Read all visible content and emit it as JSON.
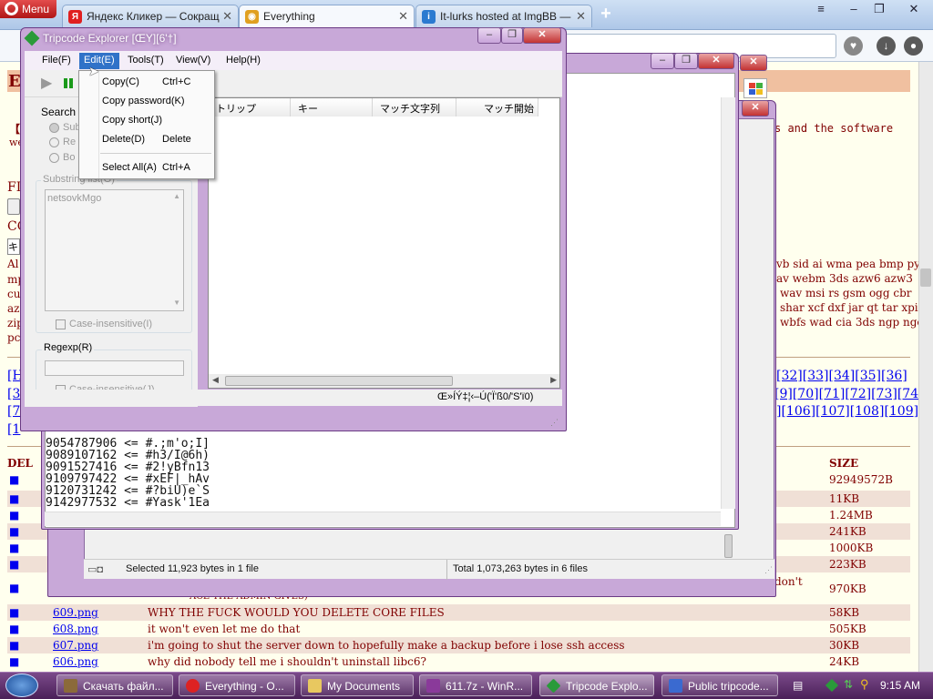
{
  "browser": {
    "menu_label": "Menu",
    "tabs": [
      {
        "label": "Яндекс Кликер — Сокращ",
        "icon": "yandex-icon"
      },
      {
        "label": "Everything",
        "icon": "everything-icon"
      },
      {
        "label": "It-lurks hosted at ImgBB —",
        "icon": "imgbb-icon"
      }
    ]
  },
  "page": {
    "header_letter": "Ev",
    "intro_left": "【",
    "intro_left2": "we",
    "intro_right": "s and the software",
    "label_fi": "FI",
    "label_cc": "CC",
    "field_left": "キ",
    "ext_lines": [
      {
        "left": "Al",
        "right": "vb sid ai wma pea bmp py"
      },
      {
        "left": "mp",
        "right": "av webm 3ds azw6 azw3"
      },
      {
        "left": "cu",
        "right": "wav msi rs gsm ogg cbr"
      },
      {
        "left": "az",
        "right": "shar xcf dxf jar qt tar xpi"
      },
      {
        "left": "zip",
        "right": "wbfs wad cia 3ds ngp ngc"
      },
      {
        "left": "pc",
        "right": ""
      }
    ],
    "pager_rows": [
      {
        "left": "[H",
        "right": [
          "[32]",
          "[33]",
          "[34]",
          "[35]",
          "[36]"
        ]
      },
      {
        "left": "[3",
        "right": [
          "[9]",
          "[70]",
          "[71]",
          "[72]",
          "[73]",
          "[74]"
        ]
      },
      {
        "left": "[7",
        "right": [
          "]",
          "[106]",
          "[107]",
          "[108]",
          "[109]"
        ]
      },
      {
        "left": "[1",
        "right": []
      }
    ],
    "files_header": {
      "del": "DEL",
      "size": "SIZE"
    },
    "hidden_sizes": [
      "92949572B",
      "11KB",
      "1.24MB",
      "241KB",
      "1000KB",
      "223KB",
      "970KB"
    ],
    "partial_comment": "don't",
    "partial_comment2": "ACE THE ADMIN GIVES)",
    "files": [
      {
        "del": "■",
        "name": "609.png",
        "comment": "WHY THE FUCK WOULD YOU DELETE CORE FILES",
        "size": "58KB"
      },
      {
        "del": "■",
        "name": "608.png",
        "comment": "it won't even let me do that",
        "size": "505KB"
      },
      {
        "del": "■",
        "name": "607.png",
        "comment": "i'm going to shut the server down to hopefully make a backup before i lose ssh access",
        "size": "30KB"
      },
      {
        "del": "■",
        "name": "606.png",
        "comment": "why did nobody tell me i shouldn't uninstall libc6?",
        "size": "24KB"
      }
    ]
  },
  "console": {
    "lines": [
      "9054787906 <= #.;m'o;I]",
      "9089107162 <= #h3/I@6h)",
      "9091527416 <= #2!yBfn13",
      "9109797422 <= #xEF|_hAv",
      "9120731242 <= #?biU)e`S",
      "9142977532 <= #Yask'1Ea"
    ]
  },
  "everything": {
    "status_left": "Selected 11,923 bytes in 1 file",
    "status_right": "Total 1,073,263 bytes in 6 files"
  },
  "tripcode": {
    "title": "Tripcode Explorer [ŒY][6'†]",
    "menus": [
      "File(F)",
      "Edit(E)",
      "Tools(T)",
      "View(V)",
      "Help(H)"
    ],
    "search_label": "Search",
    "radio_labels": [
      "Sub",
      "Re",
      "Bo"
    ],
    "substring_label": "Substring list(G)",
    "substring_value": "netsovkMgo",
    "case_insensitive_1": "Case-insensitive(I)",
    "regexp_label": "Regexp(R)",
    "case_insensitive_2": "Case-insensitive(J)",
    "columns": [
      "トリップ",
      "キー",
      "マッチ文字列",
      "マッチ開始"
    ],
    "status": "Œ»ÍÝ‡¦‹–Ú('Ï'ß0/'S'ï0)",
    "edit_menu": [
      {
        "label": "Copy(C)",
        "key": "Ctrl+C"
      },
      {
        "label": "Copy password(K)",
        "key": ""
      },
      {
        "label": "Copy short(J)",
        "key": ""
      },
      {
        "label": "Delete(D)",
        "key": "Delete"
      },
      {
        "label": "Select All(A)",
        "key": "Ctrl+A"
      }
    ]
  },
  "taskbar": {
    "tasks": [
      {
        "label": "Скачать файл...",
        "icon": "download-icon"
      },
      {
        "label": "Everything - O...",
        "icon": "opera-icon"
      },
      {
        "label": "My Documents",
        "icon": "folder-icon"
      },
      {
        "label": "611.7z - WinR...",
        "icon": "winrar-icon"
      },
      {
        "label": "Tripcode Explo...",
        "icon": "tripcode-icon"
      },
      {
        "label": "Public tripcode...",
        "icon": "document-icon"
      }
    ],
    "clock": "9:15 AM"
  },
  "colors": {
    "page_bg": "#ffffee",
    "page_text": "#800000",
    "link": "#0000ee",
    "window_frame": "#c8a8d8",
    "taskbar": "#5a2a6a",
    "menu_highlight": "#3072c8"
  }
}
